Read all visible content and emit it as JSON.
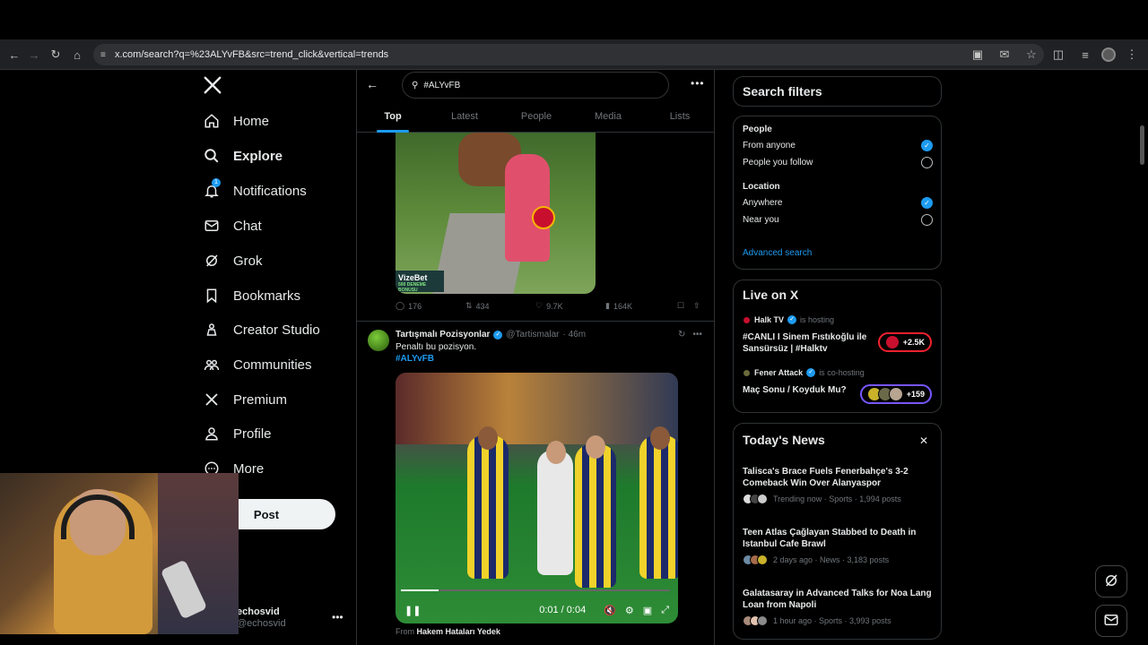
{
  "browser": {
    "url": "x.com/search?q=%23ALYvFB&src=trend_click&vertical=trends"
  },
  "sidebar": {
    "items": [
      {
        "label": "Home",
        "icon": "home-icon"
      },
      {
        "label": "Explore",
        "icon": "search-icon",
        "active": true
      },
      {
        "label": "Notifications",
        "icon": "bell-icon",
        "badge": "1"
      },
      {
        "label": "Chat",
        "icon": "mail-icon"
      },
      {
        "label": "Grok",
        "icon": "grok-icon"
      },
      {
        "label": "Bookmarks",
        "icon": "bookmark-icon"
      },
      {
        "label": "Creator Studio",
        "icon": "creator-icon"
      },
      {
        "label": "Communities",
        "icon": "communities-icon"
      },
      {
        "label": "Premium",
        "icon": "x-icon"
      },
      {
        "label": "Profile",
        "icon": "person-icon"
      },
      {
        "label": "More",
        "icon": "more-circle-icon"
      }
    ],
    "post_label": "Post",
    "user": {
      "name": "echosvid",
      "handle": "@echosvid"
    }
  },
  "search": {
    "query": "#ALYvFB",
    "tabs": [
      "Top",
      "Latest",
      "People",
      "Media",
      "Lists"
    ],
    "active_tab": "Top"
  },
  "tweet1": {
    "image_badge": "VizeBet",
    "image_badge_sub": "500 DENEME BONUSU",
    "replies": "176",
    "retweets": "434",
    "likes": "9.7K",
    "views": "164K"
  },
  "tweet2": {
    "name": "Tartışmalı Pozisyonlar",
    "handle": "@Tartismalar",
    "time": "· 46m",
    "text": "Penaltı bu pozisyon.",
    "hashtag": "#ALYvFB",
    "video_time": "0:01 / 0:04",
    "from_prefix": "From",
    "from_source": "Hakem Hataları Yedek"
  },
  "filters": {
    "title": "Search filters",
    "people_label": "People",
    "people_options": [
      {
        "label": "From anyone",
        "selected": true
      },
      {
        "label": "People you follow",
        "selected": false
      }
    ],
    "location_label": "Location",
    "location_options": [
      {
        "label": "Anywhere",
        "selected": true
      },
      {
        "label": "Near you",
        "selected": false
      }
    ],
    "advanced": "Advanced search"
  },
  "live": {
    "title": "Live on X",
    "items": [
      {
        "host": "Halk TV",
        "status": "is hosting",
        "title": "#CANLI I Sinem Fıstıkoğlu ile Sansürsüz | #Halktv",
        "count": "+2.5K"
      },
      {
        "host": "Fener Attack",
        "status": "is co-hosting",
        "title": "Maç Sonu / Koyduk Mu?",
        "count": "+159"
      }
    ]
  },
  "news": {
    "title": "Today's News",
    "items": [
      {
        "title": "Talisca's Brace Fuels Fenerbahçe's 3-2 Comeback Win Over Alanyaspor",
        "meta": "Trending now · Sports · 1,994 posts"
      },
      {
        "title": "Teen Atlas Çağlayan Stabbed to Death in Istanbul Cafe Brawl",
        "meta": "2 days ago · News · 3,183 posts"
      },
      {
        "title": "Galatasaray in Advanced Talks for Noa Lang Loan from Napoli",
        "meta": "1 hour ago · Sports · 3,993 posts"
      }
    ]
  },
  "colors": {
    "accent": "#1d9bf0",
    "live_red": "#f4212e",
    "live_purple": "#7856ff"
  }
}
